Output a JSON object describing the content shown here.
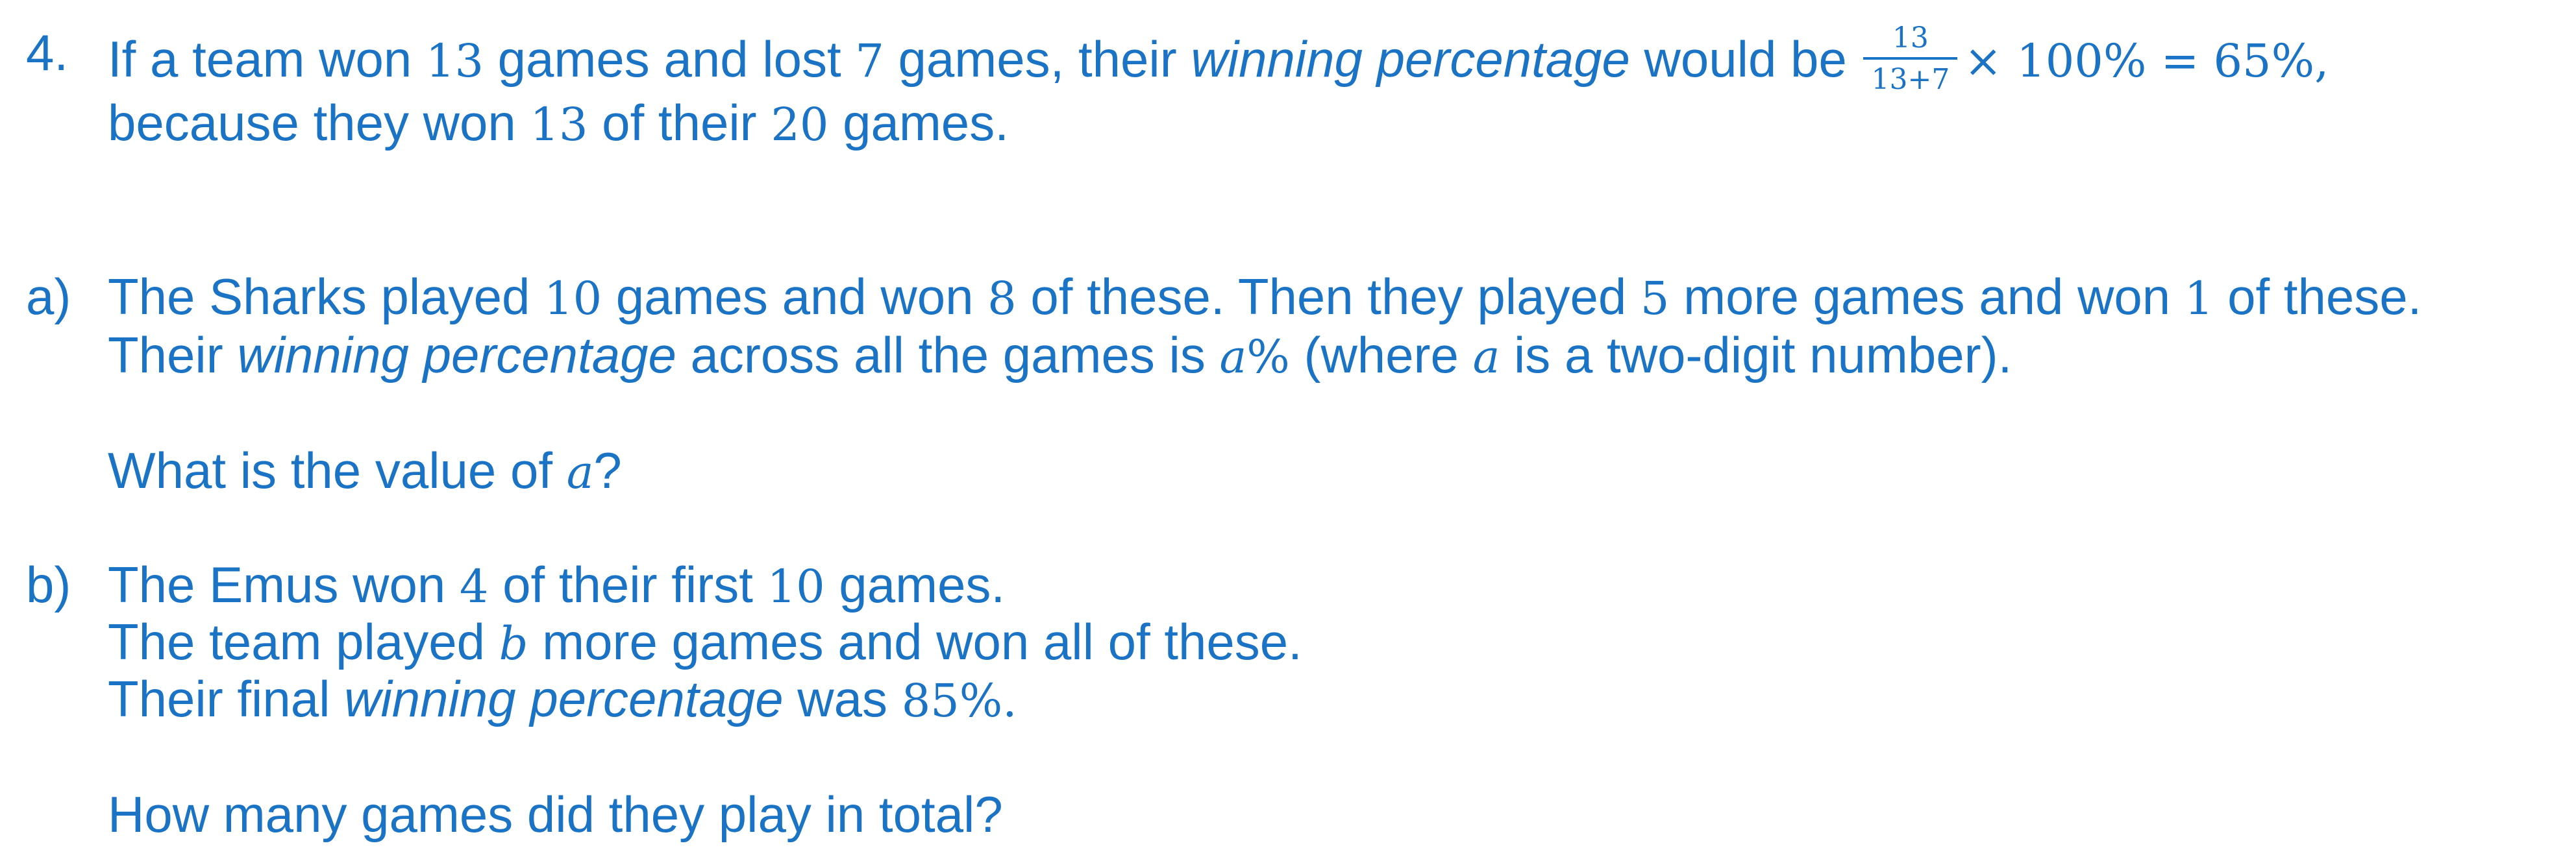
{
  "intro": {
    "number": "4.",
    "l1_a": "If a team won ",
    "l1_n1": "13",
    "l1_b": " games and lost ",
    "l1_n2": "7",
    "l1_c": " games, their ",
    "l1_em": "winning percentage",
    "l1_d": " would be ",
    "frac_num": "13",
    "frac_den": "13+7",
    "l1_math": "× 100% = 65%,",
    "l2_a": "because they won ",
    "l2_n1": "13",
    "l2_b": " of their ",
    "l2_n2": "20",
    "l2_c": " games."
  },
  "part_a": {
    "label": "a)",
    "l1_a": "The Sharks played ",
    "l1_n1": "10",
    "l1_b": " games and won ",
    "l1_n2": "8",
    "l1_c": " of these. Then they played ",
    "l1_n3": "5",
    "l1_d": " more games and won ",
    "l1_n4": "1",
    "l1_e": " of these.",
    "l2_a": "Their ",
    "l2_em": "winning percentage",
    "l2_b": " across all the games is ",
    "l2_var": "a",
    "l2_pct": "%",
    "l2_c": " (where ",
    "l2_var2": "a",
    "l2_d": " is a two-digit number).",
    "q_a": "What is the value of ",
    "q_var": "a",
    "q_b": "?"
  },
  "part_b": {
    "label": "b)",
    "l1_a": "The Emus won ",
    "l1_n1": "4",
    "l1_b": " of their first ",
    "l1_n2": "10",
    "l1_c": " games.",
    "l2_a": "The team played ",
    "l2_var": "b",
    "l2_b": " more games and won all of these.",
    "l3_a": "Their final ",
    "l3_em": "winning percentage",
    "l3_b": " was ",
    "l3_n": "85%.",
    "q": "How many games did they play in total?"
  }
}
